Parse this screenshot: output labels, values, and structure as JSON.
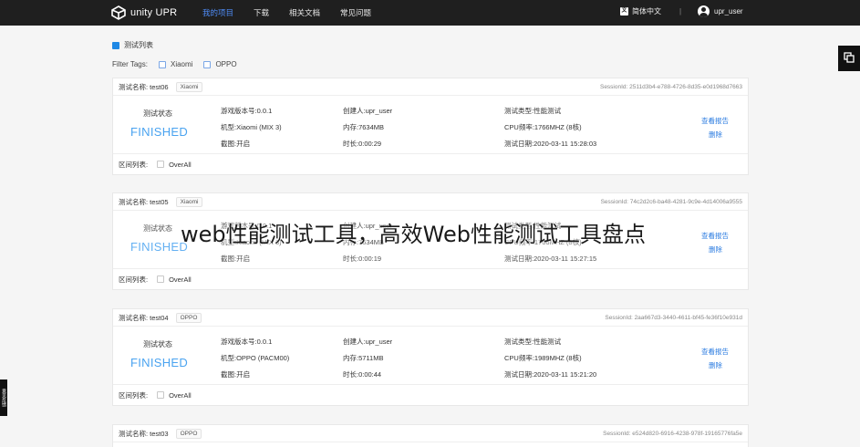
{
  "header": {
    "logo_text": "unity UPR",
    "nav": [
      "我的项目",
      "下载",
      "相关文档",
      "常见问题"
    ],
    "language": "简体中文",
    "language_icon": "文",
    "separator": "|",
    "user": "upr_user"
  },
  "list": {
    "title": "测试列表",
    "filter_label": "Filter Tags:",
    "filter_options": [
      "Xiaomi",
      "OPPO"
    ]
  },
  "labels": {
    "status_label": "测试状态",
    "view_report": "查看报告",
    "delete": "删除",
    "range_label": "区间列表:",
    "overall": "OverAll"
  },
  "side": {
    "tab_text": "意见反馈"
  },
  "cards": [
    {
      "name": "测试名称: test06",
      "tag": "Xiaomi",
      "session": "SessionId: 2511d3b4-e788-4726-8d35-e0d1968d7663",
      "status": "FINISHED",
      "game_version": "游戏版本号:0.0.1",
      "model": "机型:Xiaomi (MIX 3)",
      "screenshot": "截图:开启",
      "creator": "创建人:upr_user",
      "memory": "内存:7634MB",
      "duration": "时长:0:00:29",
      "test_type": "测试类型:性能测试",
      "cpu": "CPU频率:1766MHZ (8核)",
      "date": "测试日期:2020-03-11 15:28:03"
    },
    {
      "name": "测试名称: test05",
      "tag": "Xiaomi",
      "session": "SessionId: 74c2d2c6-ba48-4281-9c9e-4d14006a9555",
      "status": "FINISHED",
      "game_version": "游戏版本号:0.0.1",
      "model": "机型:Xiaomi (MIX 3)",
      "screenshot": "截图:开启",
      "creator": "创建人:upr_user",
      "memory": "内存:7634MB",
      "duration": "时长:0:00:19",
      "test_type": "测试类型:性能测试",
      "cpu": "CPU频率:1766MHZ (8核)",
      "date": "测试日期:2020-03-11 15:27:15"
    },
    {
      "name": "测试名称: test04",
      "tag": "OPPO",
      "session": "SessionId: 2aa667d3-3440-4611-bf45-fe36f10e931d",
      "status": "FINISHED",
      "game_version": "游戏版本号:0.0.1",
      "model": "机型:OPPO (PACM00)",
      "screenshot": "截图:开启",
      "creator": "创建人:upr_user",
      "memory": "内存:5711MB",
      "duration": "时长:0:00:44",
      "test_type": "测试类型:性能测试",
      "cpu": "CPU频率:1989MHZ (8核)",
      "date": "测试日期:2020-03-11 15:21:20"
    },
    {
      "name": "测试名称: test03",
      "tag": "OPPO",
      "session": "SessionId: e524d820-6916-4238-978f-19165776fa5e"
    }
  ],
  "overlay": {
    "caption": "web性能测试工具，高效Web性能测试工具盘点"
  }
}
